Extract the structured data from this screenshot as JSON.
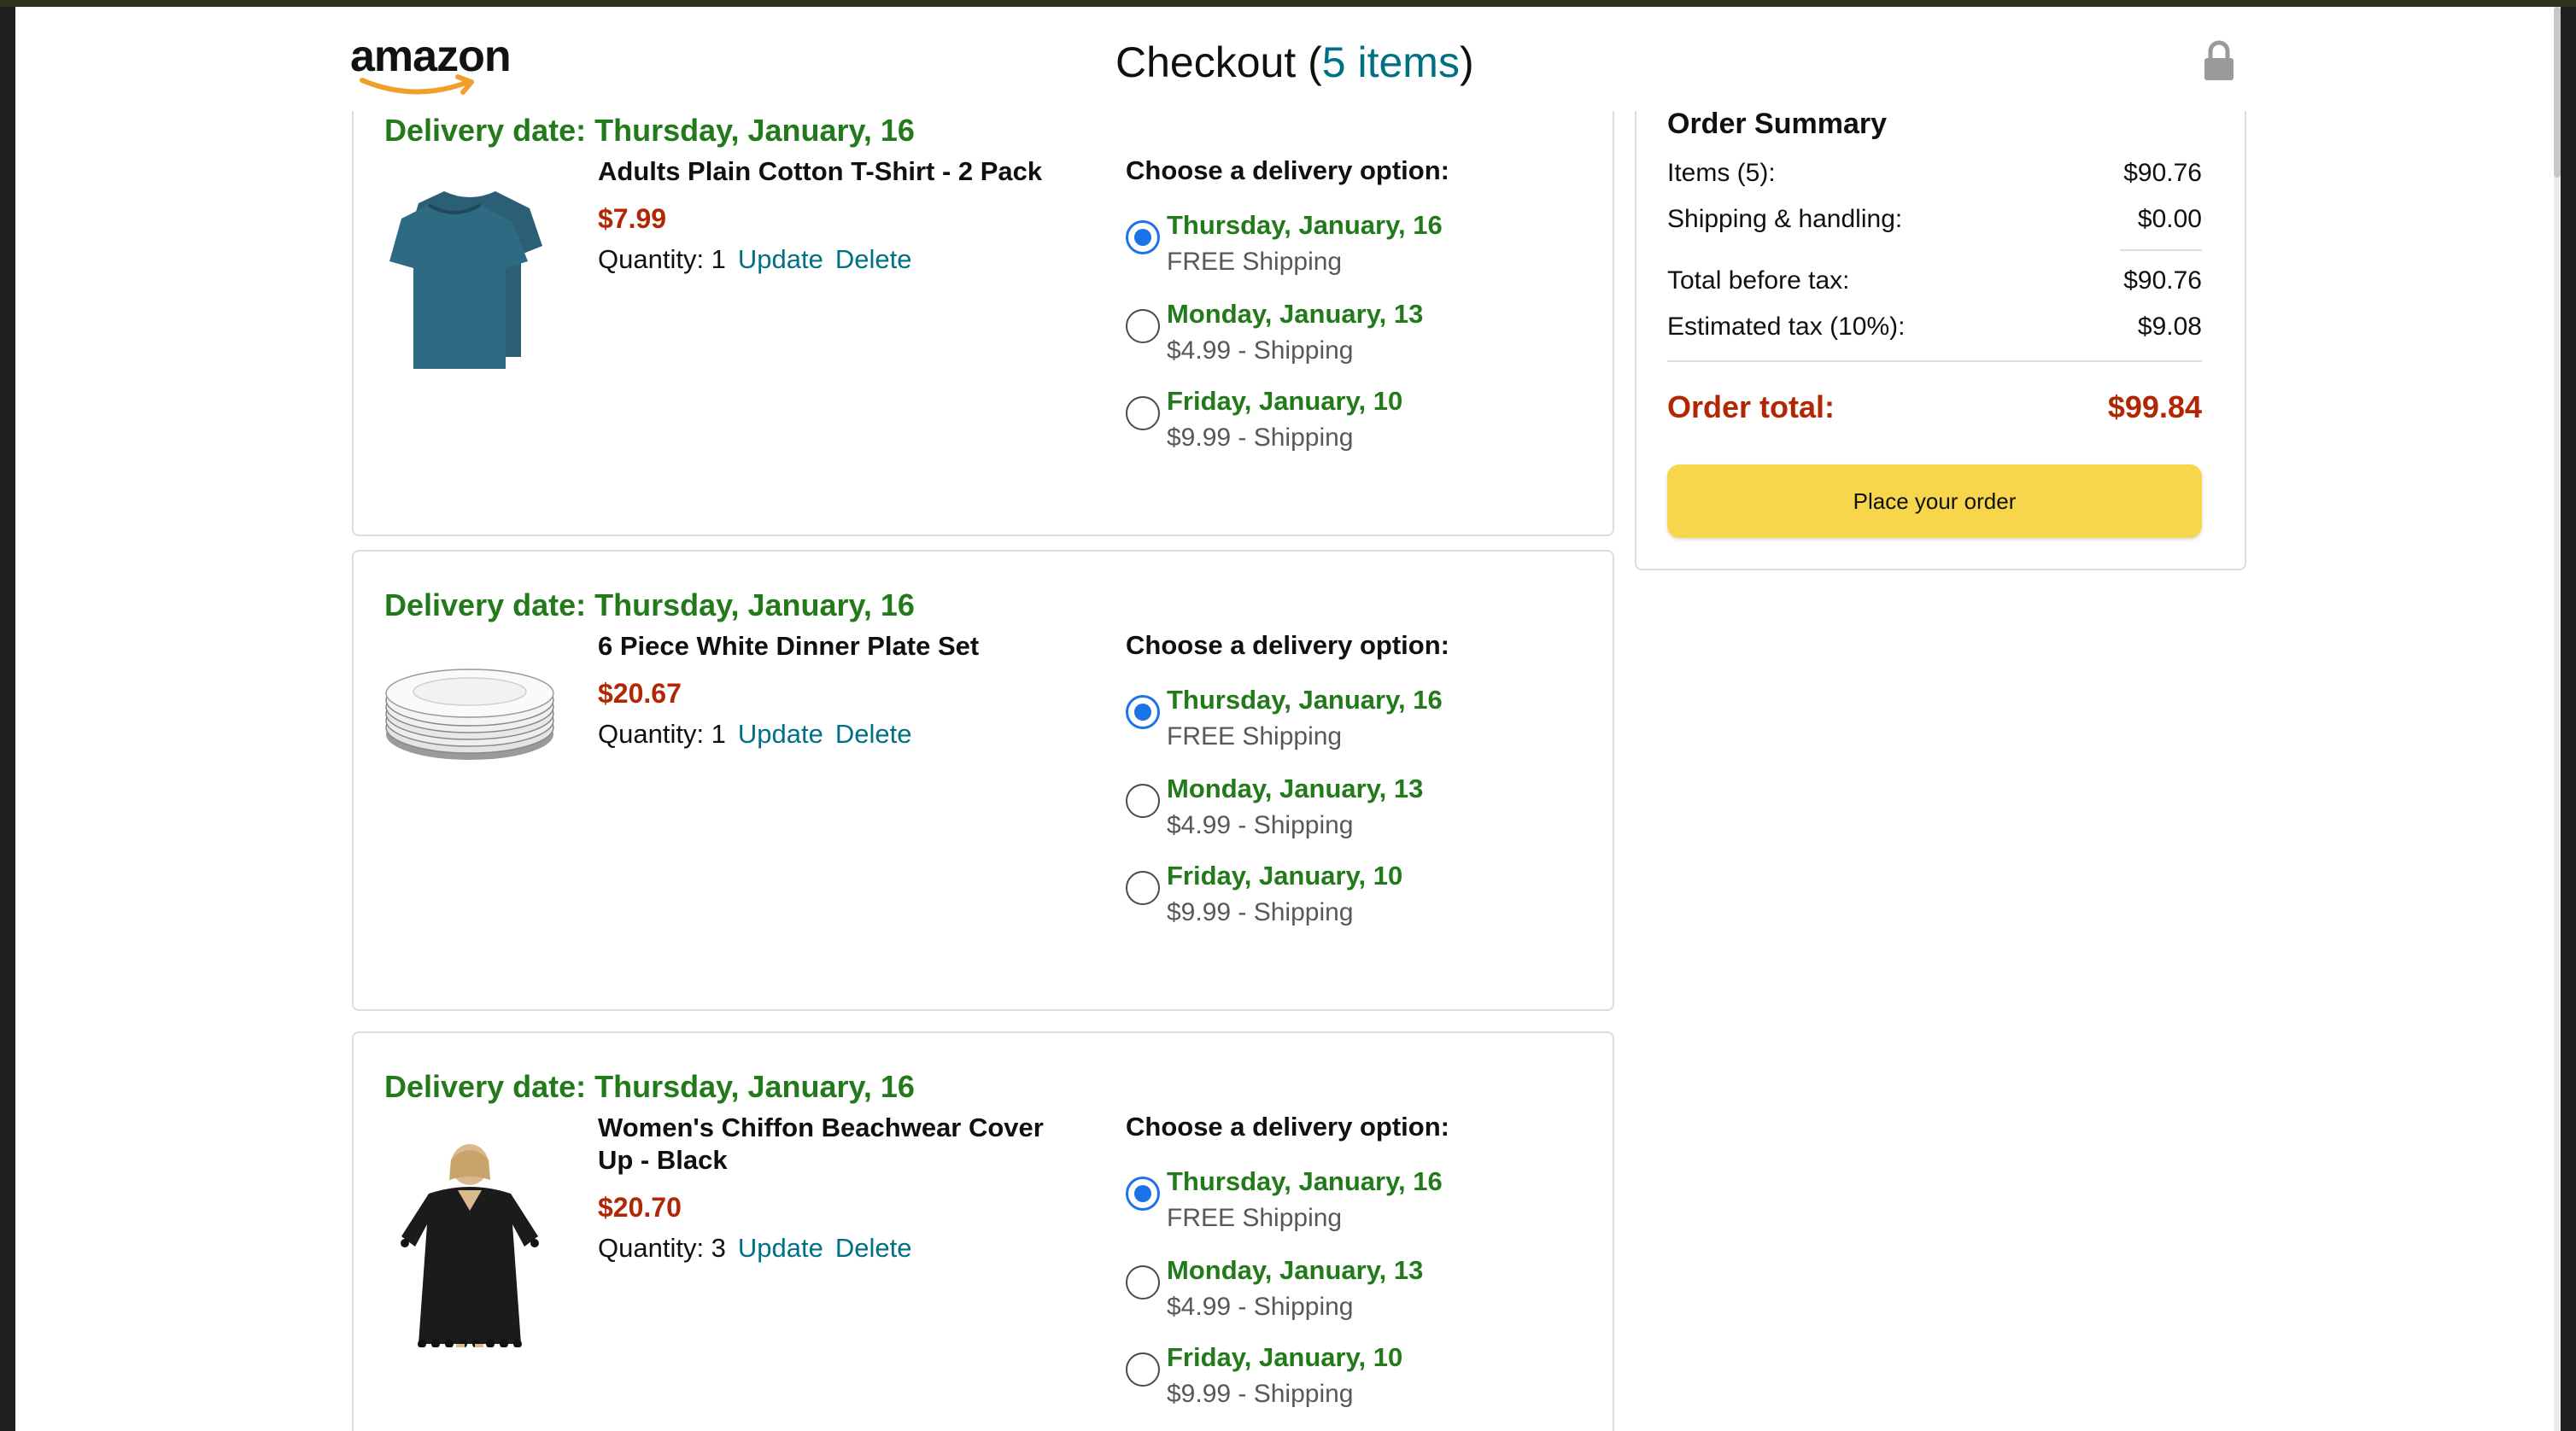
{
  "header": {
    "logo_text": "amazon",
    "title_prefix": "Checkout (",
    "title_count": "5 items",
    "title_suffix": ")"
  },
  "orders": [
    {
      "delivery_date": "Delivery date: Thursday, January, 16",
      "product_name": "Adults Plain Cotton T-Shirt - 2 Pack",
      "price": "$7.99",
      "quantity_label": "Quantity: 1",
      "update_label": "Update",
      "delete_label": "Delete",
      "choose_label": "Choose a delivery option:",
      "options": [
        {
          "date": "Thursday, January, 16",
          "shipping": "FREE Shipping",
          "selected": true
        },
        {
          "date": "Monday, January, 13",
          "shipping": "$4.99 - Shipping",
          "selected": false
        },
        {
          "date": "Friday, January, 10",
          "shipping": "$9.99 - Shipping",
          "selected": false
        }
      ]
    },
    {
      "delivery_date": "Delivery date: Thursday, January, 16",
      "product_name": "6 Piece White Dinner Plate Set",
      "price": "$20.67",
      "quantity_label": "Quantity: 1",
      "update_label": "Update",
      "delete_label": "Delete",
      "choose_label": "Choose a delivery option:",
      "options": [
        {
          "date": "Thursday, January, 16",
          "shipping": "FREE Shipping",
          "selected": true
        },
        {
          "date": "Monday, January, 13",
          "shipping": "$4.99 - Shipping",
          "selected": false
        },
        {
          "date": "Friday, January, 10",
          "shipping": "$9.99 - Shipping",
          "selected": false
        }
      ]
    },
    {
      "delivery_date": "Delivery date: Thursday, January, 16",
      "product_name": "Women's Chiffon Beachwear Cover Up - Black",
      "price": "$20.70",
      "quantity_label": "Quantity: 3",
      "update_label": "Update",
      "delete_label": "Delete",
      "choose_label": "Choose a delivery option:",
      "options": [
        {
          "date": "Thursday, January, 16",
          "shipping": "FREE Shipping",
          "selected": true
        },
        {
          "date": "Monday, January, 13",
          "shipping": "$4.99 - Shipping",
          "selected": false
        },
        {
          "date": "Friday, January, 10",
          "shipping": "$9.99 - Shipping",
          "selected": false
        }
      ]
    }
  ],
  "summary": {
    "title": "Order Summary",
    "items_label": "Items (5):",
    "items_value": "$90.76",
    "shipping_label": "Shipping & handling:",
    "shipping_value": "$0.00",
    "before_tax_label": "Total before tax:",
    "before_tax_value": "$90.76",
    "tax_label": "Estimated tax (10%):",
    "tax_value": "$9.08",
    "total_label": "Order total:",
    "total_value": "$99.84",
    "place_order_label": "Place your order"
  },
  "colors": {
    "delivery_green": "#237a1a",
    "price_red": "#b12704",
    "link_teal": "#007185",
    "button_yellow": "#f7d64b",
    "radio_blue": "#1a73e8"
  },
  "icons": [
    "amazon-smile-logo",
    "lock-icon",
    "radio-selected",
    "radio-unselected"
  ]
}
